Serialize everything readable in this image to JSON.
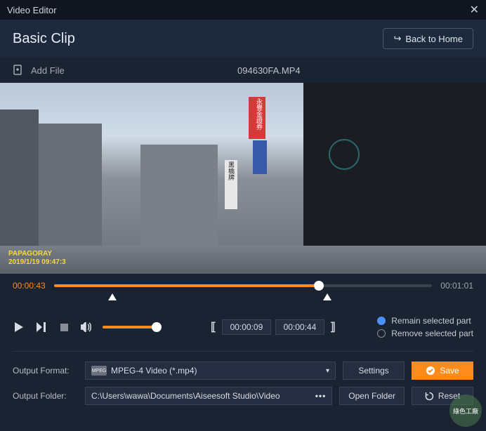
{
  "titlebar": {
    "title": "Video Editor"
  },
  "header": {
    "title": "Basic Clip",
    "back_label": "Back to Home"
  },
  "toolbar": {
    "add_file": "Add File",
    "filename": "094630FA.MP4"
  },
  "watermark": {
    "line1": "PAPAGORAY",
    "line2": "2019/1/19 09:47:3"
  },
  "signs": {
    "red": "永豐金證券",
    "white": "黑橋牌"
  },
  "timeline": {
    "current": "00:00:43",
    "duration": "00:01:01"
  },
  "clip": {
    "start": "00:00:09",
    "end": "00:00:44"
  },
  "options": {
    "remain": "Remain selected part",
    "remove": "Remove selected part"
  },
  "output": {
    "format_label": "Output Format:",
    "format_value": "MPEG-4 Video (*.mp4)",
    "folder_label": "Output Folder:",
    "folder_value": "C:\\Users\\wawa\\Documents\\Aiseesoft Studio\\Video",
    "settings": "Settings",
    "open_folder": "Open Folder",
    "save": "Save",
    "reset": "Reset"
  },
  "badge": "綠色工廠"
}
